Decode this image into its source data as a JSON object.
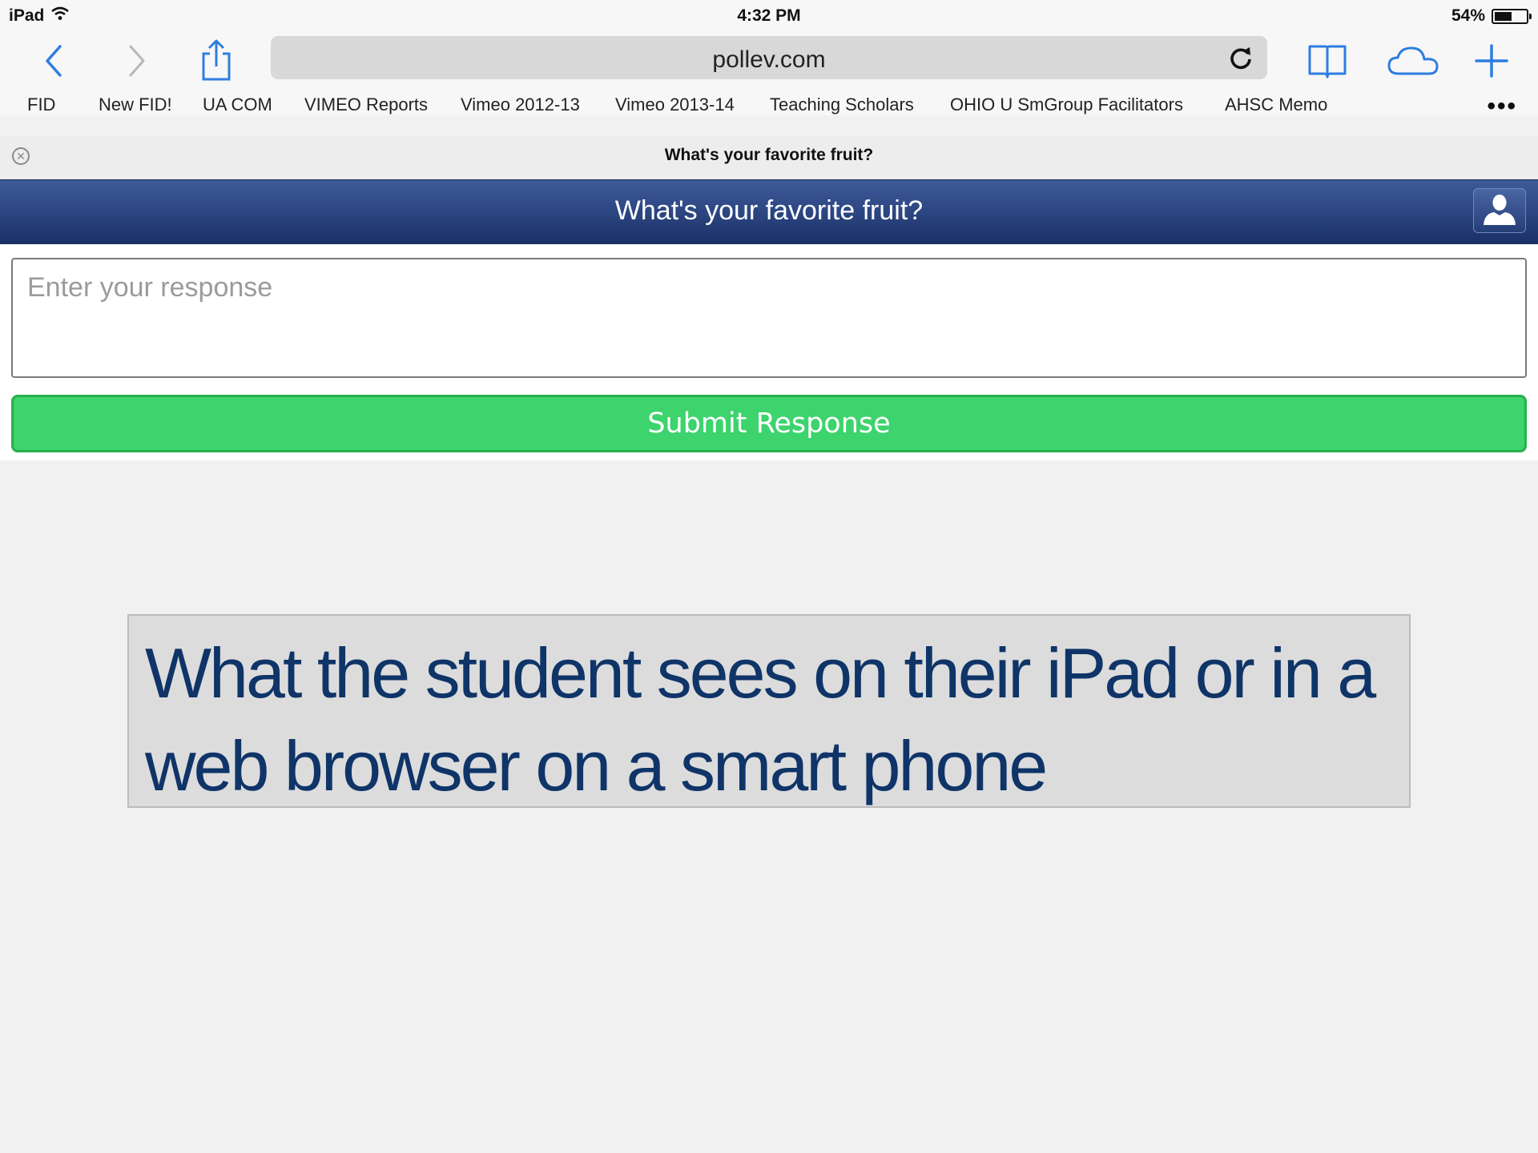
{
  "status_bar": {
    "device": "iPad",
    "time": "4:32 PM",
    "battery_text": "54%",
    "battery_level": 0.54
  },
  "toolbar": {
    "url": "pollev.com",
    "icons": [
      "back-chevron",
      "forward-chevron",
      "share",
      "reload",
      "bookmarks-book",
      "icloud-tabs",
      "new-tab-plus"
    ]
  },
  "bookmarks": [
    "FID",
    "New FID!",
    "UA COM",
    "VIMEO Reports",
    "Vimeo 2012-13",
    "Vimeo 2013-14",
    "Teaching Scholars",
    "OHIO U SmGroup Facilitators",
    "AHSC Memo"
  ],
  "tab": {
    "title": "What's your favorite fruit?"
  },
  "poll": {
    "header_title": "What's your favorite fruit?",
    "response_placeholder": "Enter your response",
    "submit_label": "Submit Response"
  },
  "caption": {
    "text": "What the student sees on their iPad or in a web browser on a smart phone"
  },
  "colors": {
    "header_blue": "#2c4682",
    "submit_green": "#3dd36d",
    "caption_text": "#0f3468",
    "ios_blue": "#2f7de1"
  }
}
